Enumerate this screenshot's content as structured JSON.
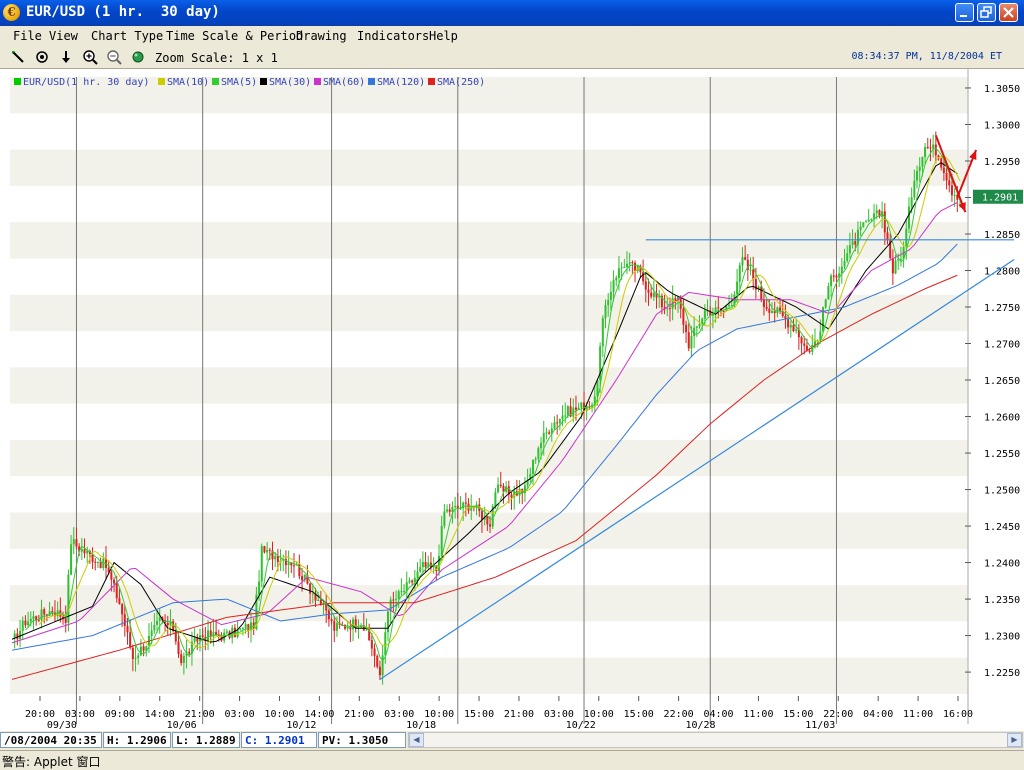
{
  "window": {
    "title": "EUR/USD (1 hr.  30 day)"
  },
  "menu": [
    "File",
    "View",
    "Chart Type",
    "Time Scale & Period",
    "Drawing",
    "Indicators",
    "Help"
  ],
  "toolbar": {
    "zoom_label": "Zoom Scale: 1 x 1",
    "clock": "08:34:37 PM, 11/8/2004 ET",
    "icons": [
      "line-tool-icon",
      "target-icon",
      "down-arrow-icon",
      "zoom-in-icon",
      "zoom-out-icon",
      "globe-icon"
    ]
  },
  "chart_data": {
    "type": "candlestick",
    "legend": [
      {
        "name": "EUR/USD(1 hr.  30 day)",
        "color": "#00cc00"
      },
      {
        "name": "SMA(10)",
        "color": "#cccc00"
      },
      {
        "name": "SMA(5)",
        "color": "#33cc33"
      },
      {
        "name": "SMA(30)",
        "color": "#000000"
      },
      {
        "name": "SMA(60)",
        "color": "#cc33cc"
      },
      {
        "name": "SMA(120)",
        "color": "#3377dd"
      },
      {
        "name": "SMA(250)",
        "color": "#dd2222"
      }
    ],
    "y_ticks": [
      "1.3050",
      "1.3000",
      "1.2950",
      "1.2900",
      "1.2850",
      "1.2800",
      "1.2750",
      "1.2700",
      "1.2650",
      "1.2600",
      "1.2550",
      "1.2500",
      "1.2450",
      "1.2400",
      "1.2350",
      "1.2300",
      "1.2250"
    ],
    "ylim": [
      1.222,
      1.3065
    ],
    "current_price": "1.2901",
    "x_ticks": [
      {
        "time": "20:00",
        "date": ""
      },
      {
        "time": "03:00",
        "date": "09/30"
      },
      {
        "time": "09:00",
        "date": ""
      },
      {
        "time": "14:00",
        "date": ""
      },
      {
        "time": "21:00",
        "date": "10/06"
      },
      {
        "time": "03:00",
        "date": ""
      },
      {
        "time": "10:00",
        "date": ""
      },
      {
        "time": "14:00",
        "date": "10/12"
      },
      {
        "time": "21:00",
        "date": ""
      },
      {
        "time": "03:00",
        "date": ""
      },
      {
        "time": "10:00",
        "date": "10/18"
      },
      {
        "time": "15:00",
        "date": ""
      },
      {
        "time": "21:00",
        "date": ""
      },
      {
        "time": "03:00",
        "date": ""
      },
      {
        "time": "10:00",
        "date": "10/22"
      },
      {
        "time": "15:00",
        "date": ""
      },
      {
        "time": "22:00",
        "date": ""
      },
      {
        "time": "04:00",
        "date": "10/28"
      },
      {
        "time": "11:00",
        "date": ""
      },
      {
        "time": "15:00",
        "date": ""
      },
      {
        "time": "22:00",
        "date": "11/03"
      },
      {
        "time": "04:00",
        "date": ""
      },
      {
        "time": "11:00",
        "date": ""
      },
      {
        "time": "16:00",
        "date": ""
      }
    ],
    "price_path": [
      [
        0,
        1.229
      ],
      [
        5,
        1.232
      ],
      [
        15,
        1.2335
      ],
      [
        20,
        1.2325
      ],
      [
        22,
        1.243
      ],
      [
        25,
        1.242
      ],
      [
        35,
        1.2395
      ],
      [
        40,
        1.2345
      ],
      [
        45,
        1.227
      ],
      [
        50,
        1.229
      ],
      [
        55,
        1.232
      ],
      [
        60,
        1.231
      ],
      [
        63,
        1.2265
      ],
      [
        70,
        1.23
      ],
      [
        80,
        1.23
      ],
      [
        90,
        1.2315
      ],
      [
        93,
        1.2415
      ],
      [
        98,
        1.241
      ],
      [
        105,
        1.24
      ],
      [
        110,
        1.237
      ],
      [
        115,
        1.2345
      ],
      [
        120,
        1.231
      ],
      [
        130,
        1.232
      ],
      [
        135,
        1.2275
      ],
      [
        137,
        1.224
      ],
      [
        140,
        1.234
      ],
      [
        148,
        1.237
      ],
      [
        153,
        1.2395
      ],
      [
        158,
        1.239
      ],
      [
        161,
        1.247
      ],
      [
        166,
        1.2475
      ],
      [
        171,
        1.248
      ],
      [
        175,
        1.2465
      ],
      [
        178,
        1.2455
      ],
      [
        180,
        1.25
      ],
      [
        186,
        1.2495
      ],
      [
        191,
        1.25
      ],
      [
        196,
        1.256
      ],
      [
        201,
        1.259
      ],
      [
        206,
        1.2605
      ],
      [
        213,
        1.2615
      ],
      [
        217,
        1.262
      ],
      [
        220,
        1.273
      ],
      [
        224,
        1.279
      ],
      [
        228,
        1.281
      ],
      [
        233,
        1.28
      ],
      [
        237,
        1.2775
      ],
      [
        243,
        1.275
      ],
      [
        248,
        1.276
      ],
      [
        252,
        1.27
      ],
      [
        258,
        1.2745
      ],
      [
        265,
        1.2745
      ],
      [
        268,
        1.276
      ],
      [
        272,
        1.2815
      ],
      [
        276,
        1.279
      ],
      [
        280,
        1.2755
      ],
      [
        286,
        1.274
      ],
      [
        292,
        1.272
      ],
      [
        296,
        1.269
      ],
      [
        300,
        1.2705
      ],
      [
        304,
        1.278
      ],
      [
        310,
        1.2815
      ],
      [
        316,
        1.2855
      ],
      [
        320,
        1.287
      ],
      [
        324,
        1.288
      ],
      [
        328,
        1.28
      ],
      [
        332,
        1.283
      ],
      [
        336,
        1.293
      ],
      [
        340,
        1.297
      ],
      [
        344,
        1.2965
      ],
      [
        347,
        1.294
      ],
      [
        350,
        1.291
      ],
      [
        353,
        1.2901
      ]
    ],
    "candles_total": 353,
    "sma_paths": {
      "SMA(30)": [
        [
          0,
          1.2295
        ],
        [
          30,
          1.234
        ],
        [
          38,
          1.24
        ],
        [
          48,
          1.237
        ],
        [
          58,
          1.231
        ],
        [
          75,
          1.229
        ],
        [
          85,
          1.231
        ],
        [
          96,
          1.238
        ],
        [
          112,
          1.236
        ],
        [
          128,
          1.231
        ],
        [
          140,
          1.231
        ],
        [
          152,
          1.238
        ],
        [
          170,
          1.244
        ],
        [
          185,
          1.2495
        ],
        [
          197,
          1.2525
        ],
        [
          212,
          1.26
        ],
        [
          225,
          1.271
        ],
        [
          235,
          1.28
        ],
        [
          245,
          1.277
        ],
        [
          262,
          1.274
        ],
        [
          275,
          1.278
        ],
        [
          292,
          1.275
        ],
        [
          304,
          1.272
        ],
        [
          318,
          1.28
        ],
        [
          330,
          1.285
        ],
        [
          345,
          1.295
        ],
        [
          353,
          1.293
        ]
      ],
      "SMA(60)": [
        [
          0,
          1.229
        ],
        [
          25,
          1.232
        ],
        [
          45,
          1.2395
        ],
        [
          60,
          1.235
        ],
        [
          78,
          1.2315
        ],
        [
          95,
          1.233
        ],
        [
          110,
          1.238
        ],
        [
          130,
          1.236
        ],
        [
          145,
          1.2325
        ],
        [
          160,
          1.239
        ],
        [
          185,
          1.245
        ],
        [
          205,
          1.254
        ],
        [
          225,
          1.265
        ],
        [
          240,
          1.274
        ],
        [
          252,
          1.277
        ],
        [
          270,
          1.276
        ],
        [
          290,
          1.276
        ],
        [
          305,
          1.274
        ],
        [
          320,
          1.28
        ],
        [
          335,
          1.283
        ],
        [
          345,
          1.288
        ],
        [
          353,
          1.2895
        ]
      ],
      "SMA(120)": [
        [
          0,
          1.228
        ],
        [
          30,
          1.23
        ],
        [
          60,
          1.2345
        ],
        [
          80,
          1.235
        ],
        [
          100,
          1.232
        ],
        [
          120,
          1.233
        ],
        [
          140,
          1.2335
        ],
        [
          160,
          1.238
        ],
        [
          185,
          1.242
        ],
        [
          205,
          1.247
        ],
        [
          225,
          1.256
        ],
        [
          240,
          1.263
        ],
        [
          255,
          1.269
        ],
        [
          270,
          1.272
        ],
        [
          290,
          1.2735
        ],
        [
          310,
          1.275
        ],
        [
          330,
          1.278
        ],
        [
          345,
          1.281
        ],
        [
          353,
          1.284
        ]
      ],
      "SMA(250)": [
        [
          0,
          1.224
        ],
        [
          40,
          1.228
        ],
        [
          80,
          1.2325
        ],
        [
          120,
          1.2345
        ],
        [
          150,
          1.2345
        ],
        [
          180,
          1.238
        ],
        [
          210,
          1.243
        ],
        [
          240,
          1.252
        ],
        [
          260,
          1.259
        ],
        [
          280,
          1.265
        ],
        [
          300,
          1.27
        ],
        [
          320,
          1.274
        ],
        [
          340,
          1.2775
        ],
        [
          353,
          1.2795
        ]
      ]
    },
    "trendlines": [
      {
        "from": [
          137,
          1.224
        ],
        "to": [
          362,
          1.2815
        ],
        "color": "#3388dd"
      },
      {
        "from": [
          236,
          1.2842
        ],
        "to": [
          362,
          1.2842
        ],
        "color": "#3388dd"
      }
    ],
    "red_arrows": [
      {
        "from": [
          344,
          1.2985
        ],
        "to": [
          355,
          1.288
        ]
      },
      {
        "from": [
          352,
          1.29
        ],
        "to": [
          359,
          1.2965
        ]
      }
    ],
    "vlines_at_candle": [
      24,
      71,
      119,
      166,
      213,
      260,
      307
    ]
  },
  "status": {
    "datetime": "/08/2004 20:35",
    "high": "H: 1.2906",
    "low": "L: 1.2889",
    "close": "C: 1.2901",
    "pv": "PV: 1.3050"
  },
  "footer": {
    "warning": "警告: Applet 窗口"
  }
}
